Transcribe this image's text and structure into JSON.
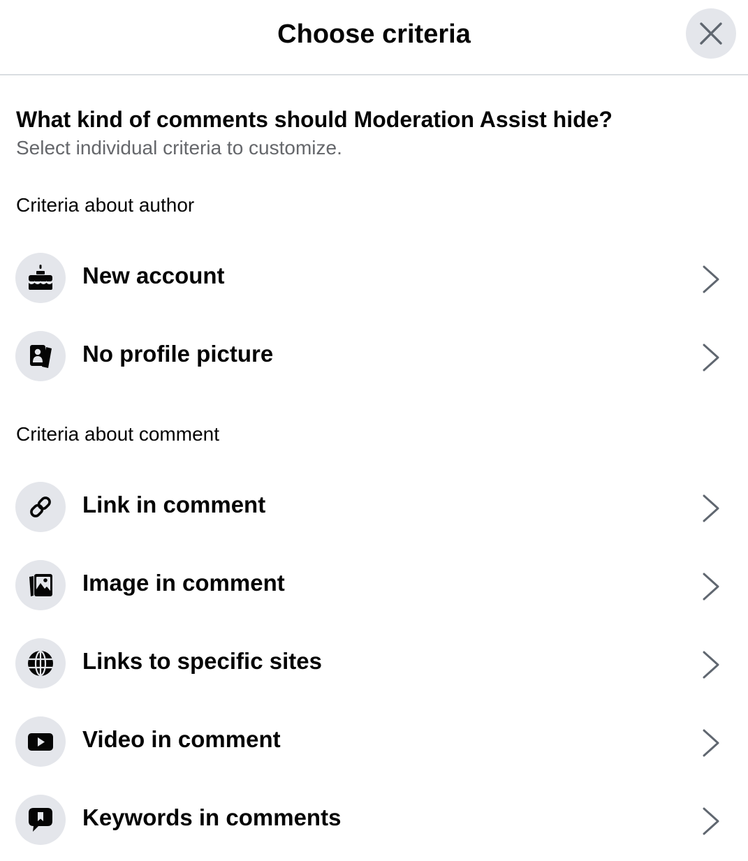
{
  "header": {
    "title": "Choose criteria",
    "close_icon": "close-icon"
  },
  "intro": {
    "question": "What kind of comments should Moderation Assist hide?",
    "hint": "Select individual criteria to customize."
  },
  "sections": {
    "author": {
      "label": "Criteria about author",
      "items": [
        {
          "label": "New account",
          "icon": "birthday-cake-icon"
        },
        {
          "label": "No profile picture",
          "icon": "profile-card-icon"
        }
      ]
    },
    "comment": {
      "label": "Criteria about comment",
      "items": [
        {
          "label": "Link in comment",
          "icon": "link-icon"
        },
        {
          "label": "Image in comment",
          "icon": "photo-icon"
        },
        {
          "label": "Links to specific sites",
          "icon": "globe-icon"
        },
        {
          "label": "Video in comment",
          "icon": "video-play-icon"
        },
        {
          "label": "Keywords in comments",
          "icon": "speech-bubble-alert-icon"
        }
      ]
    }
  },
  "colors": {
    "icon_bg": "#e4e6eb",
    "divider": "#dadde1",
    "secondary_text": "#65676b",
    "primary_text": "#050505"
  }
}
